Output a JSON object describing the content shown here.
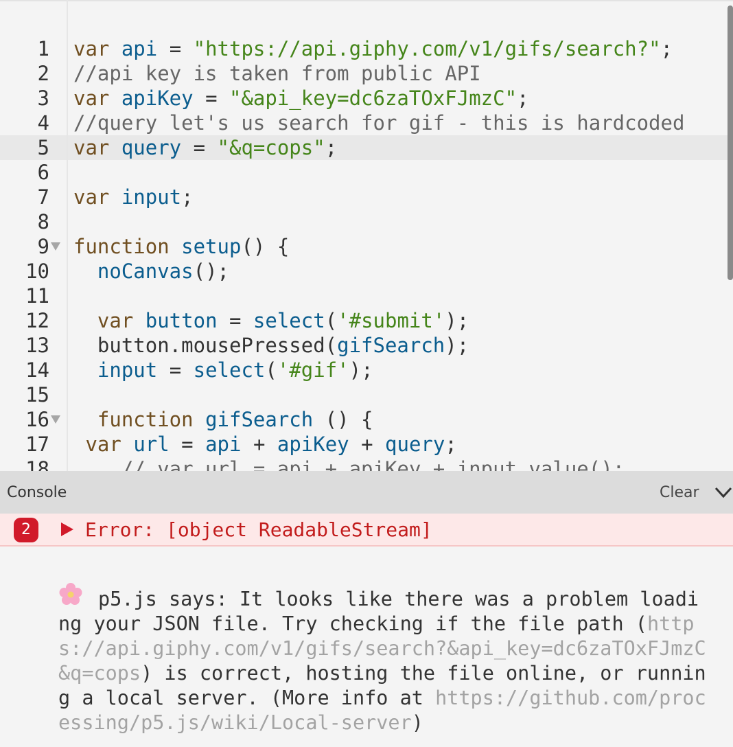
{
  "editor": {
    "lines": [
      {
        "num": "1",
        "tokens": [
          {
            "t": "kw",
            "v": "var "
          },
          {
            "t": "var",
            "v": "api"
          },
          {
            "t": "p",
            "v": " = "
          },
          {
            "t": "str",
            "v": "\"https://api.giphy.com/v1/gifs/search?\""
          },
          {
            "t": "p",
            "v": ";"
          }
        ]
      },
      {
        "num": "2",
        "tokens": [
          {
            "t": "cm",
            "v": "//api key is taken from public API"
          }
        ]
      },
      {
        "num": "3",
        "tokens": [
          {
            "t": "kw",
            "v": "var "
          },
          {
            "t": "var",
            "v": "apiKey"
          },
          {
            "t": "p",
            "v": " = "
          },
          {
            "t": "str",
            "v": "\"&api_key=dc6zaTOxFJmzC\""
          },
          {
            "t": "p",
            "v": ";"
          }
        ]
      },
      {
        "num": "4",
        "tokens": [
          {
            "t": "cm",
            "v": "//query let's us search for gif - this is hardcoded"
          }
        ]
      },
      {
        "num": "5",
        "tokens": [
          {
            "t": "kw",
            "v": "var "
          },
          {
            "t": "var",
            "v": "query"
          },
          {
            "t": "p",
            "v": " = "
          },
          {
            "t": "str",
            "v": "\"&q=cops\""
          },
          {
            "t": "p",
            "v": ";"
          }
        ]
      },
      {
        "num": "6",
        "tokens": []
      },
      {
        "num": "7",
        "tokens": [
          {
            "t": "kw",
            "v": "var "
          },
          {
            "t": "var",
            "v": "input"
          },
          {
            "t": "p",
            "v": ";"
          }
        ]
      },
      {
        "num": "8",
        "tokens": []
      },
      {
        "num": "9",
        "fold": true,
        "tokens": [
          {
            "t": "kw",
            "v": "function "
          },
          {
            "t": "fn",
            "v": "setup"
          },
          {
            "t": "p",
            "v": "() {"
          }
        ]
      },
      {
        "num": "10",
        "tokens": [
          {
            "t": "p",
            "v": "  "
          },
          {
            "t": "fn",
            "v": "noCanvas"
          },
          {
            "t": "p",
            "v": "();"
          }
        ]
      },
      {
        "num": "11",
        "tokens": []
      },
      {
        "num": "12",
        "tokens": [
          {
            "t": "p",
            "v": "  "
          },
          {
            "t": "kw",
            "v": "var "
          },
          {
            "t": "var",
            "v": "button"
          },
          {
            "t": "p",
            "v": " = "
          },
          {
            "t": "fn",
            "v": "select"
          },
          {
            "t": "p",
            "v": "("
          },
          {
            "t": "str",
            "v": "'#submit'"
          },
          {
            "t": "p",
            "v": ");"
          }
        ]
      },
      {
        "num": "13",
        "tokens": [
          {
            "t": "p",
            "v": "  button.mousePressed("
          },
          {
            "t": "var",
            "v": "gifSearch"
          },
          {
            "t": "p",
            "v": ");"
          }
        ]
      },
      {
        "num": "14",
        "tokens": [
          {
            "t": "p",
            "v": "  "
          },
          {
            "t": "var",
            "v": "input"
          },
          {
            "t": "p",
            "v": " = "
          },
          {
            "t": "fn",
            "v": "select"
          },
          {
            "t": "p",
            "v": "("
          },
          {
            "t": "str",
            "v": "'#gif'"
          },
          {
            "t": "p",
            "v": ");"
          }
        ]
      },
      {
        "num": "15",
        "tokens": []
      },
      {
        "num": "16",
        "fold": true,
        "tokens": [
          {
            "t": "p",
            "v": "  "
          },
          {
            "t": "kw",
            "v": "function "
          },
          {
            "t": "fn",
            "v": "gifSearch"
          },
          {
            "t": "p",
            "v": " () {"
          }
        ]
      },
      {
        "num": "17",
        "tokens": [
          {
            "t": "p",
            "v": " "
          },
          {
            "t": "kw",
            "v": "var "
          },
          {
            "t": "var",
            "v": "url"
          },
          {
            "t": "p",
            "v": " = "
          },
          {
            "t": "var",
            "v": "api"
          },
          {
            "t": "p",
            "v": " + "
          },
          {
            "t": "var",
            "v": "apiKey"
          },
          {
            "t": "p",
            "v": " + "
          },
          {
            "t": "var",
            "v": "query"
          },
          {
            "t": "p",
            "v": ";"
          }
        ]
      },
      {
        "num": "18",
        "tokens": [
          {
            "t": "cm",
            "v": "    // var url = api + apiKey + input.value();"
          }
        ]
      }
    ]
  },
  "console": {
    "title": "Console",
    "clear_label": "Clear",
    "error": {
      "count": "2",
      "text": "Error: [object ReadableStream]"
    },
    "p5_message": {
      "part1": "p5.js says: It looks like there was a problem loading your JSON file. Try checking if the file path (",
      "url": "https://api.giphy.com/v1/gifs/search?&api_key=dc6zaTOxFJmzC&q=cops",
      "part2": ") is correct, hosting the file online, or running a local server. (More info at ",
      "link": "https://github.com/processing/p5.js/wiki/Local-server",
      "part3": ")"
    }
  }
}
